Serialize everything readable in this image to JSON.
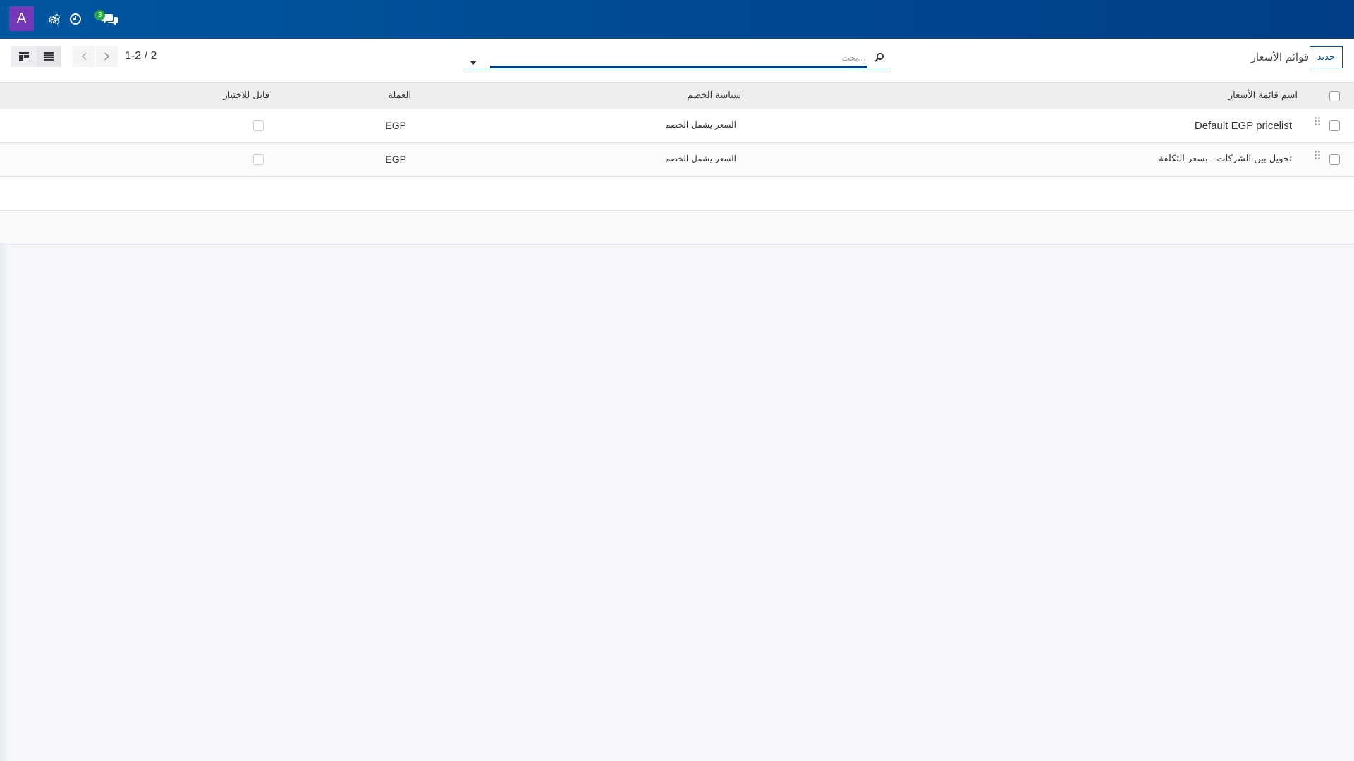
{
  "navbar": {
    "avatar_letter": "A",
    "icons": [
      "settings-cogs-icon",
      "clock-icon",
      "chat-icon"
    ],
    "chat_badge": "3",
    "colors": {
      "bg": "#00569f",
      "avatar": "#7438b8",
      "badge": "#28a745"
    }
  },
  "control": {
    "new_button": "جديد",
    "breadcrumb": "قوائم الأسعار",
    "search_placeholder": "بحث...",
    "pager": "1-2 / 2"
  },
  "table": {
    "headers": {
      "name": "اسم قائمة الأسعار",
      "discount_policy": "سياسة الخصم",
      "currency": "العملة",
      "selectable": "قابل للاختيار"
    },
    "rows": [
      {
        "name": "Default EGP pricelist",
        "discount_policy": "السعر يشمل الخصم",
        "currency": "EGP"
      },
      {
        "name": "تحويل بين الشركات - بسعر التكلفة",
        "discount_policy": "السعر يشمل الخصم",
        "currency": "EGP"
      }
    ]
  }
}
